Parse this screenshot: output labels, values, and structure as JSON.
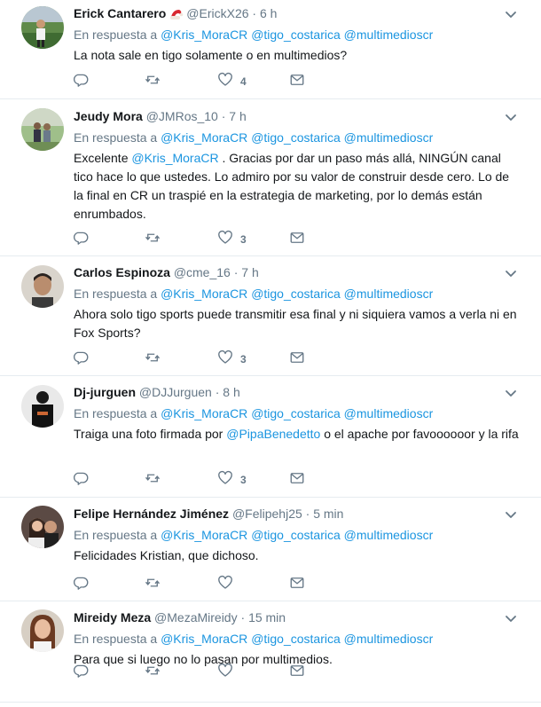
{
  "tweets": [
    {
      "name": "Erick Cantarero",
      "emoji": "santa-hat",
      "handle": "@ErickX26",
      "sep": "·",
      "time": "6 h",
      "reply_prefix": "En respuesta a",
      "mentions": [
        "@Kris_MoraCR",
        "@tigo_costarica",
        "@multimedioscr"
      ],
      "text_parts": [
        {
          "t": "La nota sale en tigo solamente o en multimedios?"
        }
      ],
      "likes": "4"
    },
    {
      "name": "Jeudy Mora",
      "handle": "@JMRos_10",
      "sep": "·",
      "time": "7 h",
      "reply_prefix": "En respuesta a",
      "mentions": [
        "@Kris_MoraCR",
        "@tigo_costarica",
        "@multimedioscr"
      ],
      "text_parts": [
        {
          "t": "Excelente "
        },
        {
          "t": "@Kris_MoraCR",
          "m": true
        },
        {
          "t": " . Gracias por dar un paso más allá, NINGÚN canal tico hace lo que ustedes. Lo admiro por su valor de construir desde cero. Lo de la final en CR un traspié en la estrategia de marketing, por lo demás están enrumbados."
        }
      ],
      "likes": "3"
    },
    {
      "name": "Carlos Espinoza",
      "handle": "@cme_16",
      "sep": "·",
      "time": "7 h",
      "reply_prefix": "En respuesta a",
      "mentions": [
        "@Kris_MoraCR",
        "@tigo_costarica",
        "@multimedioscr"
      ],
      "text_parts": [
        {
          "t": "Ahora solo tigo sports puede transmitir esa final y ni siquiera vamos a verla ni en Fox Sports?"
        }
      ],
      "likes": "3"
    },
    {
      "name": "Dj-jurguen",
      "handle": "@DJJurguen",
      "sep": "·",
      "time": "8 h",
      "reply_prefix": "En respuesta a",
      "mentions": [
        "@Kris_MoraCR",
        "@tigo_costarica",
        "@multimedioscr"
      ],
      "text_parts": [
        {
          "t": "Traiga una foto firmada por "
        },
        {
          "t": "@PipaBenedetto",
          "m": true
        },
        {
          "t": " o el apache por favoooooor y la rifa"
        }
      ],
      "likes": "3"
    },
    {
      "name": "Felipe Hernández Jiménez",
      "handle": "@Felipehj25",
      "sep": "·",
      "time": "5 min",
      "reply_prefix": "En respuesta a",
      "mentions": [
        "@Kris_MoraCR",
        "@tigo_costarica",
        "@multimedioscr"
      ],
      "text_parts": [
        {
          "t": "Felicidades Kristian, que dichoso."
        }
      ],
      "likes": ""
    },
    {
      "name": "Mireidy Meza",
      "handle": "@MezaMireidy",
      "sep": "·",
      "time": "15 min",
      "reply_prefix": "En respuesta a",
      "mentions": [
        "@Kris_MoraCR",
        "@tigo_costarica",
        "@multimedioscr"
      ],
      "text_parts": [
        {
          "t": "Para que si luego no lo pasan por multimedios."
        }
      ],
      "likes": ""
    }
  ],
  "colors": {
    "link": "#1b95e0",
    "muted": "#657786",
    "text": "#14171a",
    "border": "#e6ecf0"
  },
  "icons": {
    "reply": "reply-icon",
    "retweet": "retweet-icon",
    "like": "heart-icon",
    "dm": "envelope-icon",
    "more": "chevron-down-icon"
  }
}
